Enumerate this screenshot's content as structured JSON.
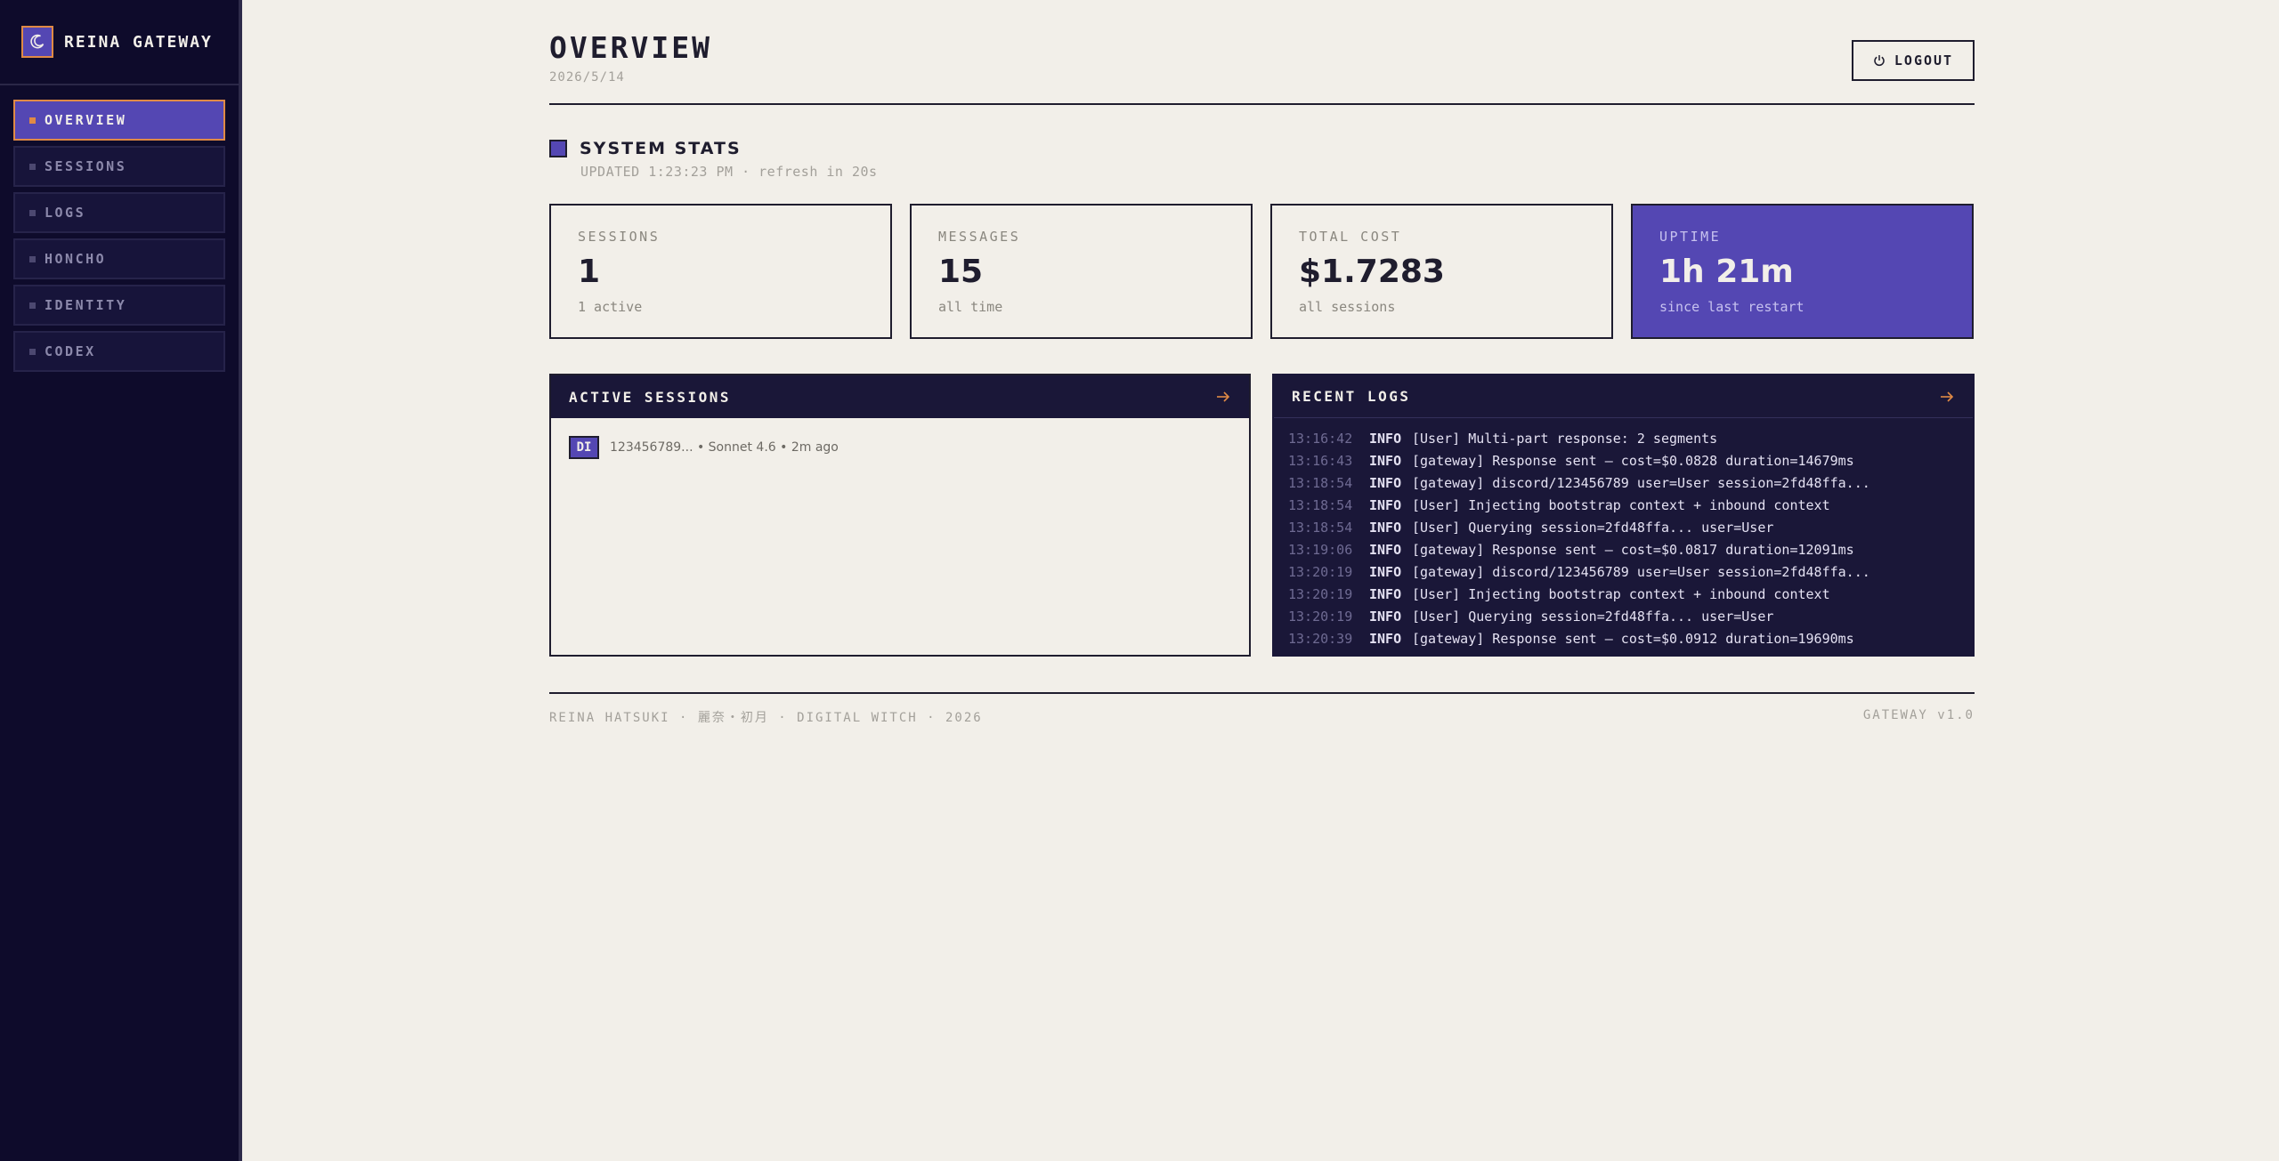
{
  "brand": {
    "name": "REINA GATEWAY",
    "logo_icon": "moon-icon"
  },
  "colors": {
    "sidebar_bg": "#0e0b2b",
    "accent": "#5447b3",
    "highlight": "#e08a45",
    "page_bg": "#f2efe9"
  },
  "nav": {
    "items": [
      {
        "label": "OVERVIEW",
        "active": true
      },
      {
        "label": "SESSIONS",
        "active": false
      },
      {
        "label": "LOGS",
        "active": false
      },
      {
        "label": "HONCHO",
        "active": false
      },
      {
        "label": "IDENTITY",
        "active": false
      },
      {
        "label": "CODEX",
        "active": false
      }
    ]
  },
  "header": {
    "title": "OVERVIEW",
    "date": "2026/5/14",
    "logout_label": "LOGOUT",
    "logout_icon": "power-icon"
  },
  "system_stats": {
    "title": "SYSTEM STATS",
    "updated": "UPDATED 1:23:23 PM · refresh in 20s",
    "cards": [
      {
        "label": "SESSIONS",
        "value": "1",
        "sub": "1 active"
      },
      {
        "label": "MESSAGES",
        "value": "15",
        "sub": "all time"
      },
      {
        "label": "TOTAL COST",
        "value": "$1.7283",
        "sub": "all sessions"
      },
      {
        "label": "UPTIME",
        "value": "1h 21m",
        "sub": "since last restart"
      }
    ]
  },
  "active_sessions": {
    "title": "ACTIVE SESSIONS",
    "arrow_icon": "arrow-right-icon",
    "items": [
      {
        "badge": "DI",
        "text": "123456789... • Sonnet 4.6 • 2m ago"
      }
    ]
  },
  "recent_logs": {
    "title": "RECENT LOGS",
    "arrow_icon": "arrow-right-icon",
    "lines": [
      {
        "time": "13:16:42",
        "level": "INFO",
        "msg": "[User] Multi-part response: 2 segments"
      },
      {
        "time": "13:16:43",
        "level": "INFO",
        "msg": "[gateway] Response sent — cost=$0.0828 duration=14679ms"
      },
      {
        "time": "13:18:54",
        "level": "INFO",
        "msg": "[gateway] discord/123456789 user=User session=2fd48ffa..."
      },
      {
        "time": "13:18:54",
        "level": "INFO",
        "msg": "[User] Injecting bootstrap context + inbound context"
      },
      {
        "time": "13:18:54",
        "level": "INFO",
        "msg": "[User] Querying session=2fd48ffa... user=User"
      },
      {
        "time": "13:19:06",
        "level": "INFO",
        "msg": "[gateway] Response sent — cost=$0.0817 duration=12091ms"
      },
      {
        "time": "13:20:19",
        "level": "INFO",
        "msg": "[gateway] discord/123456789 user=User session=2fd48ffa..."
      },
      {
        "time": "13:20:19",
        "level": "INFO",
        "msg": "[User] Injecting bootstrap context + inbound context"
      },
      {
        "time": "13:20:19",
        "level": "INFO",
        "msg": "[User] Querying session=2fd48ffa... user=User"
      },
      {
        "time": "13:20:39",
        "level": "INFO",
        "msg": "[gateway] Response sent — cost=$0.0912 duration=19690ms"
      }
    ]
  },
  "footer": {
    "left": "REINA HATSUKI · 麗奈・初月 · DIGITAL WITCH · 2026",
    "right": "GATEWAY v1.0"
  }
}
